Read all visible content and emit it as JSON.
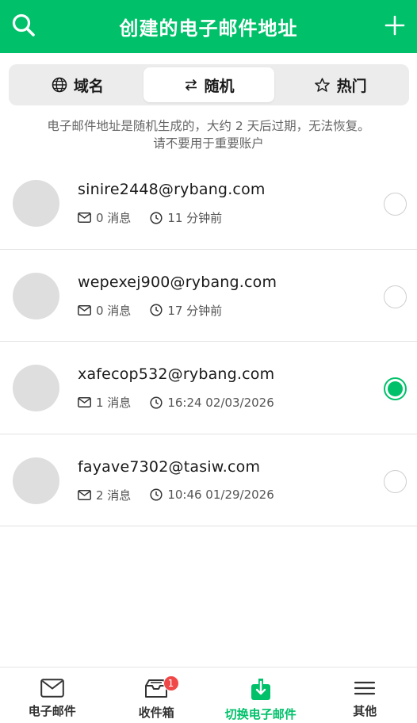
{
  "header": {
    "title": "创建的电子邮件地址"
  },
  "tabs": [
    {
      "label": "域名",
      "icon": "globe-icon",
      "active": false
    },
    {
      "label": "随机",
      "icon": "swap-arrows-icon",
      "active": true
    },
    {
      "label": "热门",
      "icon": "star-icon",
      "active": false
    }
  ],
  "notice": {
    "line1": "电子邮件地址是随机生成的，大约 2 天后过期，无法恢复。",
    "line2": "请不要用于重要账户"
  },
  "emails": [
    {
      "address": "sinire2448@rybang.com",
      "messages": "0 消息",
      "time": "11 分钟前",
      "selected": false
    },
    {
      "address": "wepexej900@rybang.com",
      "messages": "0 消息",
      "time": "17 分钟前",
      "selected": false
    },
    {
      "address": "xafecop532@rybang.com",
      "messages": "1 消息",
      "time": "16:24 02/03/2026",
      "selected": true
    },
    {
      "address": "fayave7302@tasiw.com",
      "messages": "2 消息",
      "time": "10:46 01/29/2026",
      "selected": false
    }
  ],
  "nav": {
    "items": [
      {
        "label": "电子邮件",
        "icon": "mail-icon"
      },
      {
        "label": "收件箱",
        "icon": "inbox-icon",
        "badge": "1"
      },
      {
        "label": "切换电子邮件",
        "icon": "switch-download-icon",
        "active": true
      },
      {
        "label": "其他",
        "icon": "menu-icon"
      }
    ]
  },
  "colors": {
    "accent": "#00c16a",
    "badge": "#f04848"
  }
}
